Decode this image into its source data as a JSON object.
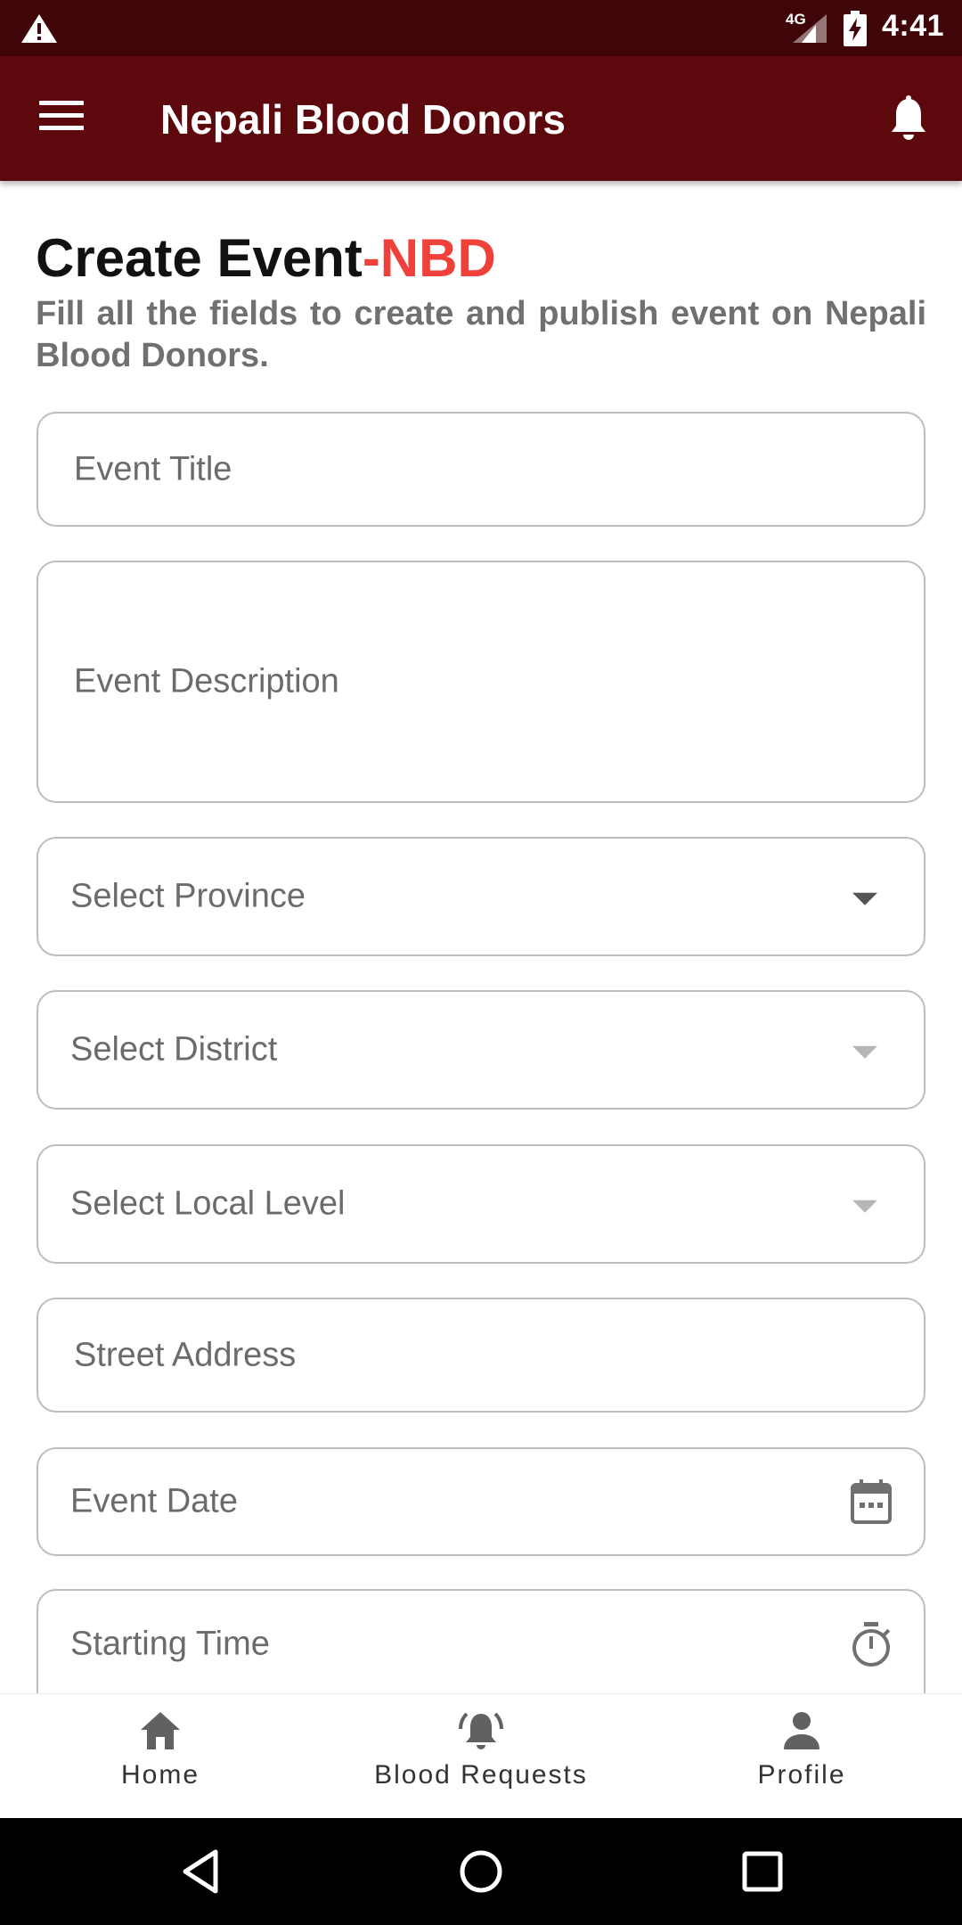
{
  "status_bar": {
    "network": "4G",
    "time": "4:41",
    "icons": [
      "warning-icon",
      "signal-icon",
      "battery-charging-icon"
    ]
  },
  "app_bar": {
    "title": "Nepali Blood Donors",
    "icons": [
      "menu-icon",
      "bell-icon"
    ]
  },
  "page": {
    "heading_main": "Create Event",
    "heading_accent": "-NBD",
    "subheading": "Fill all the fields to create and publish event on Nepali Blood Donors."
  },
  "form": {
    "event_title": "Event Title",
    "event_description": "Event Description",
    "province": "Select Province",
    "district": "Select District",
    "local_level": "Select Local Level",
    "street_address": "Street Address",
    "event_date": "Event Date",
    "starting_time": "Starting Time"
  },
  "bottom_nav": {
    "home": "Home",
    "blood_requests": "Blood Requests",
    "profile": "Profile"
  },
  "colors": {
    "status_bar": "#400508",
    "app_bar": "#5c080d",
    "accent": "#f0403a",
    "field_border": "#bdbdbd"
  }
}
